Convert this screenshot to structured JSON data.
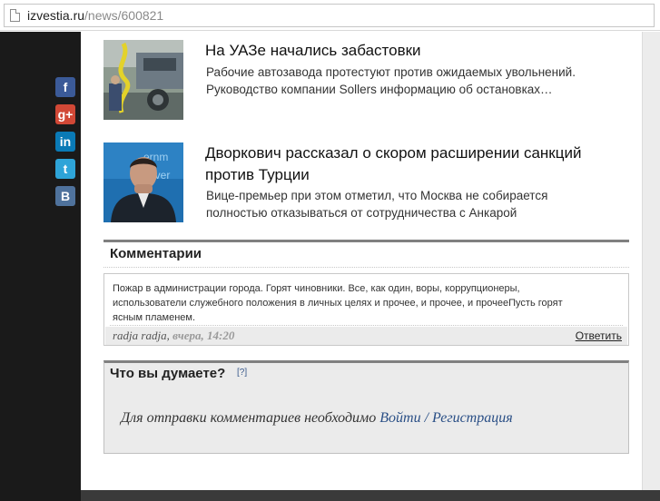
{
  "browser": {
    "url_host": "izvestia.ru",
    "url_path": "/news/600821"
  },
  "share": {
    "facebook": "f",
    "google_plus": "g+",
    "linkedin": "in",
    "twitter": "t",
    "vkontakte": "B",
    "colors": {
      "facebook": "#3b5a98",
      "google_plus": "#d14836",
      "linkedin": "#0a7ab6",
      "twitter": "#2ea4d8",
      "vkontakte": "#4f729c"
    }
  },
  "news": [
    {
      "title": "На УАЗе начались забастовки",
      "desc_line1": "Рабочие автозавода протестуют против ожидаемых увольнений.",
      "desc_line2": "Руководство компании Sollers информацию об остановках…"
    },
    {
      "title_line1": "Дворкович рассказал о скором расширении санкций",
      "title_line2": "против Турции",
      "desc_line1": "Вице-премьер при этом отметил, что Москва не собирается",
      "desc_line2": "полностью отказываться от сотрудничества с Анкарой"
    }
  ],
  "comments": {
    "title": "Комментарии",
    "items": [
      {
        "text_line1": "Пожар в администрации города. Горят чиновники. Все, как один, воры, коррупционеры,",
        "text_line2": "использователи служебного положения в личных целях и прочее, и прочее, и прочееПусть горят",
        "text_line3": "ясным пламенем.",
        "author": "radja radja",
        "separator": ", ",
        "time": "вчера, 14:20",
        "reply_label": "Ответить"
      }
    ]
  },
  "think": {
    "title": "Что вы думаете?",
    "help": "[?]",
    "message": "Для отправки комментариев необходимо ",
    "login_label": "Войти",
    "divider": " / ",
    "register_label": "Регистрация"
  }
}
